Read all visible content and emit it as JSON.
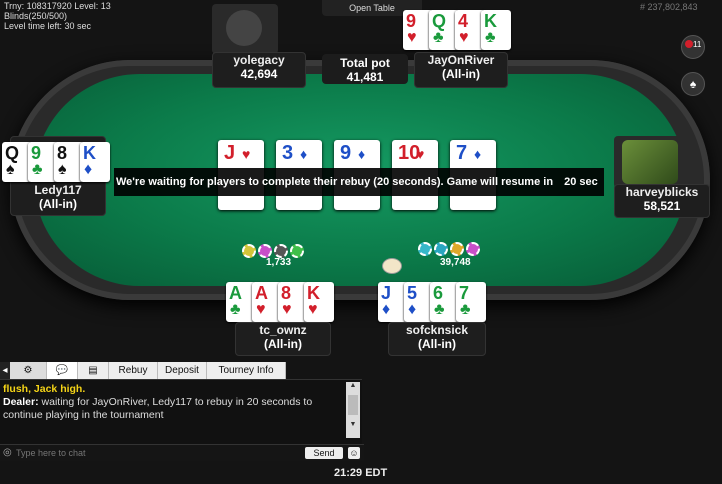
{
  "header": {
    "tourney_line": "Trny: 108317920 Level: 13",
    "blinds_line": "Blinds(250/500)",
    "level_time_line": "Level time left: 30 sec",
    "open_table_label": "Open Table",
    "hand_id": "# 237,802,843"
  },
  "pot": {
    "label": "Total pot",
    "value": "41,481"
  },
  "players": {
    "top_left": {
      "name": "yolegacy",
      "stack": "42,694"
    },
    "top_right": {
      "name": "JayOnRiver",
      "stack": "(All-in)",
      "cards": [
        {
          "rank": "9",
          "suit": "♥",
          "color": "red"
        },
        {
          "rank": "Q",
          "suit": "♣",
          "color": "grn"
        },
        {
          "rank": "4",
          "suit": "♥",
          "color": "red"
        },
        {
          "rank": "K",
          "suit": "♣",
          "color": "grn"
        }
      ]
    },
    "left": {
      "name": "Ledy117",
      "stack": "(All-in)",
      "cards": [
        {
          "rank": "Q",
          "suit": "♠",
          "color": "blk"
        },
        {
          "rank": "9",
          "suit": "♣",
          "color": "grn"
        },
        {
          "rank": "8",
          "suit": "♠",
          "color": "blk"
        },
        {
          "rank": "K",
          "suit": "♦",
          "color": "blu"
        }
      ]
    },
    "right": {
      "name": "harveyblicks",
      "stack": "58,521"
    },
    "bottom_left": {
      "name": "tc_ownz",
      "stack": "(All-in)",
      "cards": [
        {
          "rank": "A",
          "suit": "♣",
          "color": "grn"
        },
        {
          "rank": "A",
          "suit": "♥",
          "color": "red"
        },
        {
          "rank": "8",
          "suit": "♥",
          "color": "red"
        },
        {
          "rank": "K",
          "suit": "♥",
          "color": "red"
        }
      ]
    },
    "bottom_right": {
      "name": "sofcknsick",
      "stack": "(All-in)",
      "cards": [
        {
          "rank": "J",
          "suit": "♦",
          "color": "blu"
        },
        {
          "rank": "5",
          "suit": "♦",
          "color": "blu"
        },
        {
          "rank": "6",
          "suit": "♣",
          "color": "grn"
        },
        {
          "rank": "7",
          "suit": "♣",
          "color": "grn"
        }
      ]
    }
  },
  "board": [
    {
      "rank": "J",
      "suit": "♥",
      "color": "red"
    },
    {
      "rank": "3",
      "suit": "♦",
      "color": "blu"
    },
    {
      "rank": "9",
      "suit": "♦",
      "color": "blu"
    },
    {
      "rank": "10",
      "suit": "♥",
      "color": "red"
    },
    {
      "rank": "7",
      "suit": "♦",
      "color": "blu"
    }
  ],
  "waiting_message": "We're waiting for players to complete their rebuy (20 seconds). Game will resume in",
  "waiting_seconds": "20 sec",
  "bets": {
    "left": "1,733",
    "right": "39,748"
  },
  "tabs": {
    "rebuy": "Rebuy",
    "deposit": "Deposit",
    "tourney_info": "Tourney Info"
  },
  "chat": {
    "line1": "flush, Jack high.",
    "dealer_label": "Dealer:",
    "dealer_msg": "waiting for JayOnRiver, Ledy117  to rebuy in  20 seconds to continue playing in the tournament",
    "placeholder": "Type here to chat",
    "send_label": "Send"
  },
  "clock": "21:29 EDT",
  "badge_count": "11",
  "colors": {
    "felt": "#0b7a49",
    "chat_highlight": "#f5d417",
    "accent_red": "#d21f2b"
  }
}
